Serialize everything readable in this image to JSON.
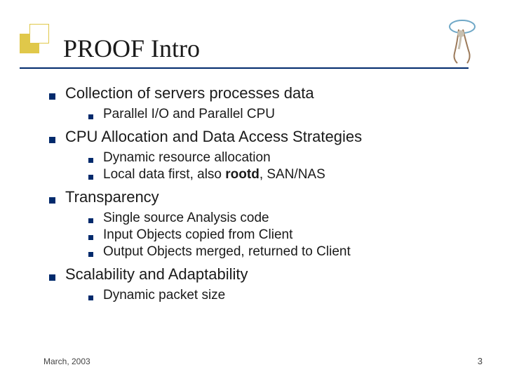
{
  "title": "PROOF Intro",
  "sections": [
    {
      "heading": "Collection of servers processes data",
      "items": [
        {
          "text": "Parallel I/O and Parallel CPU"
        }
      ]
    },
    {
      "heading": "CPU Allocation and Data Access Strategies",
      "items": [
        {
          "text": "Dynamic resource allocation"
        },
        {
          "prefix": "Local data first, also ",
          "bold": "rootd",
          "suffix": ", SAN/NAS"
        }
      ]
    },
    {
      "heading": "Transparency",
      "items": [
        {
          "text": "Single source Analysis code"
        },
        {
          "text": "Input Objects copied from Client"
        },
        {
          "text": "Output Objects merged, returned to Client"
        }
      ]
    },
    {
      "heading": "Scalability and Adaptability",
      "items": [
        {
          "text": "Dynamic packet size"
        }
      ]
    }
  ],
  "footer": {
    "date": "March, 2003",
    "page": "3"
  }
}
